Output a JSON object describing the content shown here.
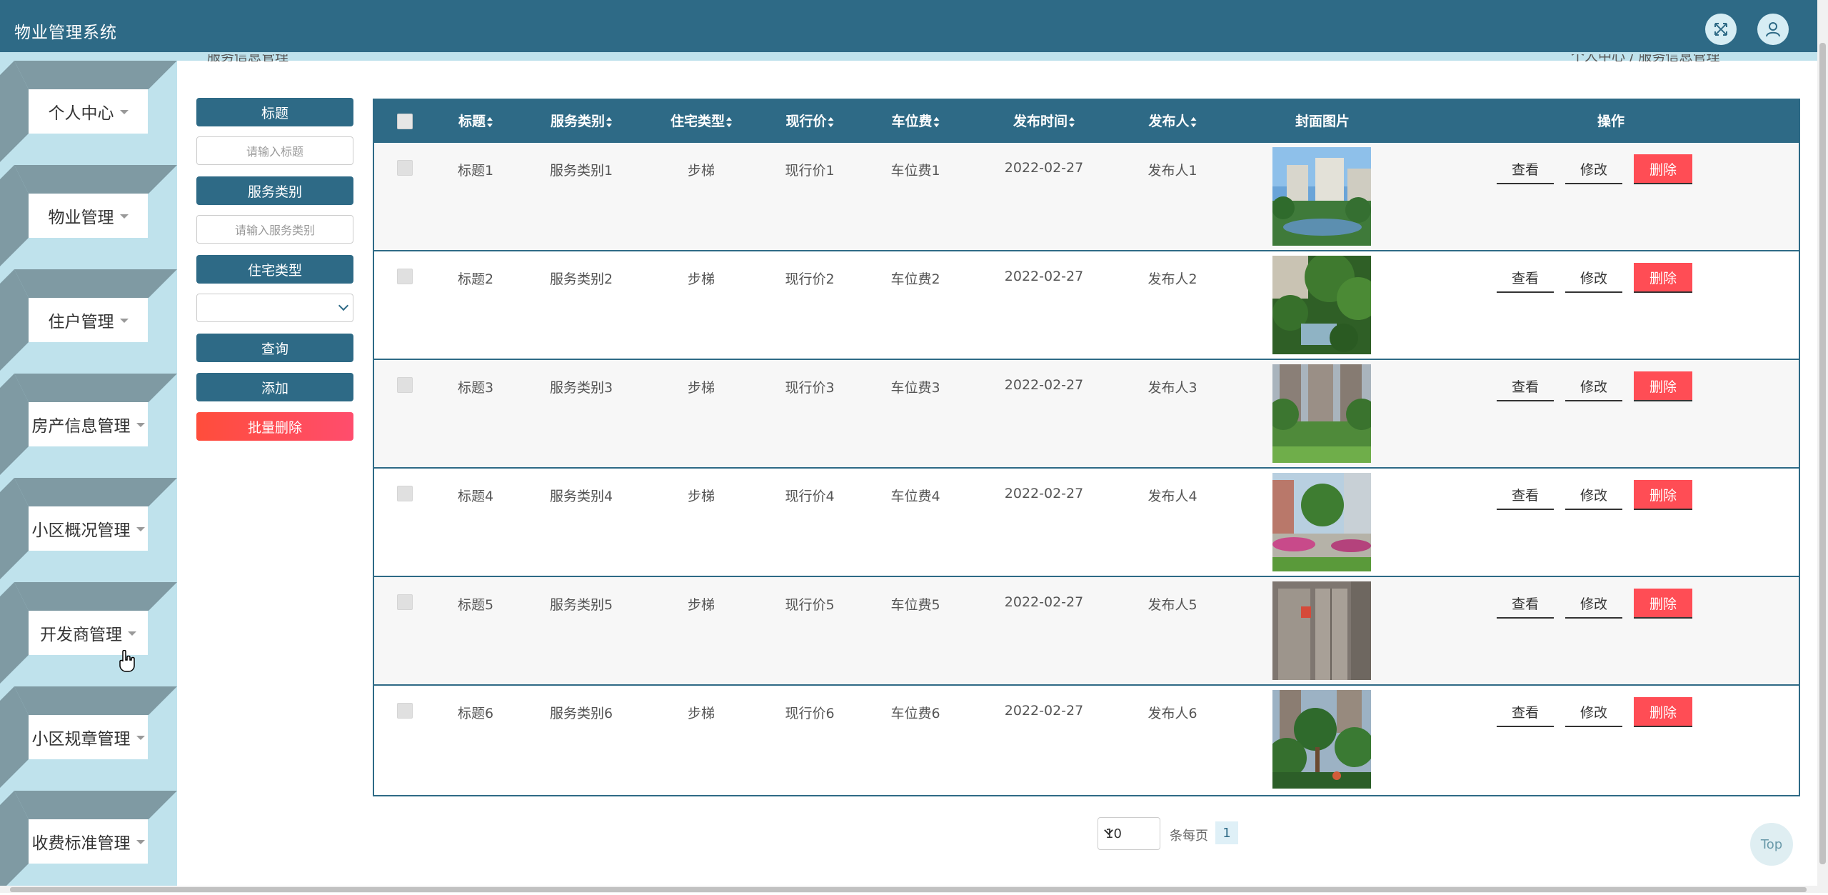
{
  "app": {
    "title": "物业管理系统"
  },
  "header": {
    "fullscreen_icon": "expand-icon",
    "user_icon": "user-icon"
  },
  "breadcrumb": {
    "left": "服务信息管理",
    "right": "个人中心 / 服务信息管理"
  },
  "sidebar": {
    "items": [
      {
        "label": "个人中心"
      },
      {
        "label": "物业管理"
      },
      {
        "label": "住户管理"
      },
      {
        "label": "房产信息管理"
      },
      {
        "label": "小区概况管理"
      },
      {
        "label": "开发商管理"
      },
      {
        "label": "小区规章管理"
      },
      {
        "label": "收费标准管理"
      }
    ]
  },
  "search": {
    "title_label": "标题",
    "title_placeholder": "请输入标题",
    "category_label": "服务类别",
    "category_placeholder": "请输入服务类别",
    "housing_label": "住宅类型",
    "housing_value": "",
    "query_button": "查询",
    "add_button": "添加",
    "batch_delete_button": "批量删除"
  },
  "table": {
    "columns": [
      "标题",
      "服务类别",
      "住宅类型",
      "现行价",
      "车位费",
      "发布时间",
      "发布人",
      "封面图片",
      "操作"
    ],
    "rows": [
      {
        "title": "标题1",
        "category": "服务类别1",
        "housing": "步梯",
        "price": "现行价1",
        "parking": "车位费1",
        "date": "2022-02-27",
        "publisher": "发布人1"
      },
      {
        "title": "标题2",
        "category": "服务类别2",
        "housing": "步梯",
        "price": "现行价2",
        "parking": "车位费2",
        "date": "2022-02-27",
        "publisher": "发布人2"
      },
      {
        "title": "标题3",
        "category": "服务类别3",
        "housing": "步梯",
        "price": "现行价3",
        "parking": "车位费3",
        "date": "2022-02-27",
        "publisher": "发布人3"
      },
      {
        "title": "标题4",
        "category": "服务类别4",
        "housing": "步梯",
        "price": "现行价4",
        "parking": "车位费4",
        "date": "2022-02-27",
        "publisher": "发布人4"
      },
      {
        "title": "标题5",
        "category": "服务类别5",
        "housing": "步梯",
        "price": "现行价5",
        "parking": "车位费5",
        "date": "2022-02-27",
        "publisher": "发布人5"
      },
      {
        "title": "标题6",
        "category": "服务类别6",
        "housing": "步梯",
        "price": "现行价6",
        "parking": "车位费6",
        "date": "2022-02-27",
        "publisher": "发布人6"
      }
    ],
    "actions": {
      "view": "查看",
      "edit": "修改",
      "delete": "删除"
    }
  },
  "pagination": {
    "page_size": "10",
    "per_page_label": "条每页",
    "current_page": "1"
  },
  "back_to_top": "Top",
  "colors": {
    "primary": "#2e6a86",
    "sidebar_bg": "#bfe2ec",
    "danger": "#ff4d55"
  }
}
